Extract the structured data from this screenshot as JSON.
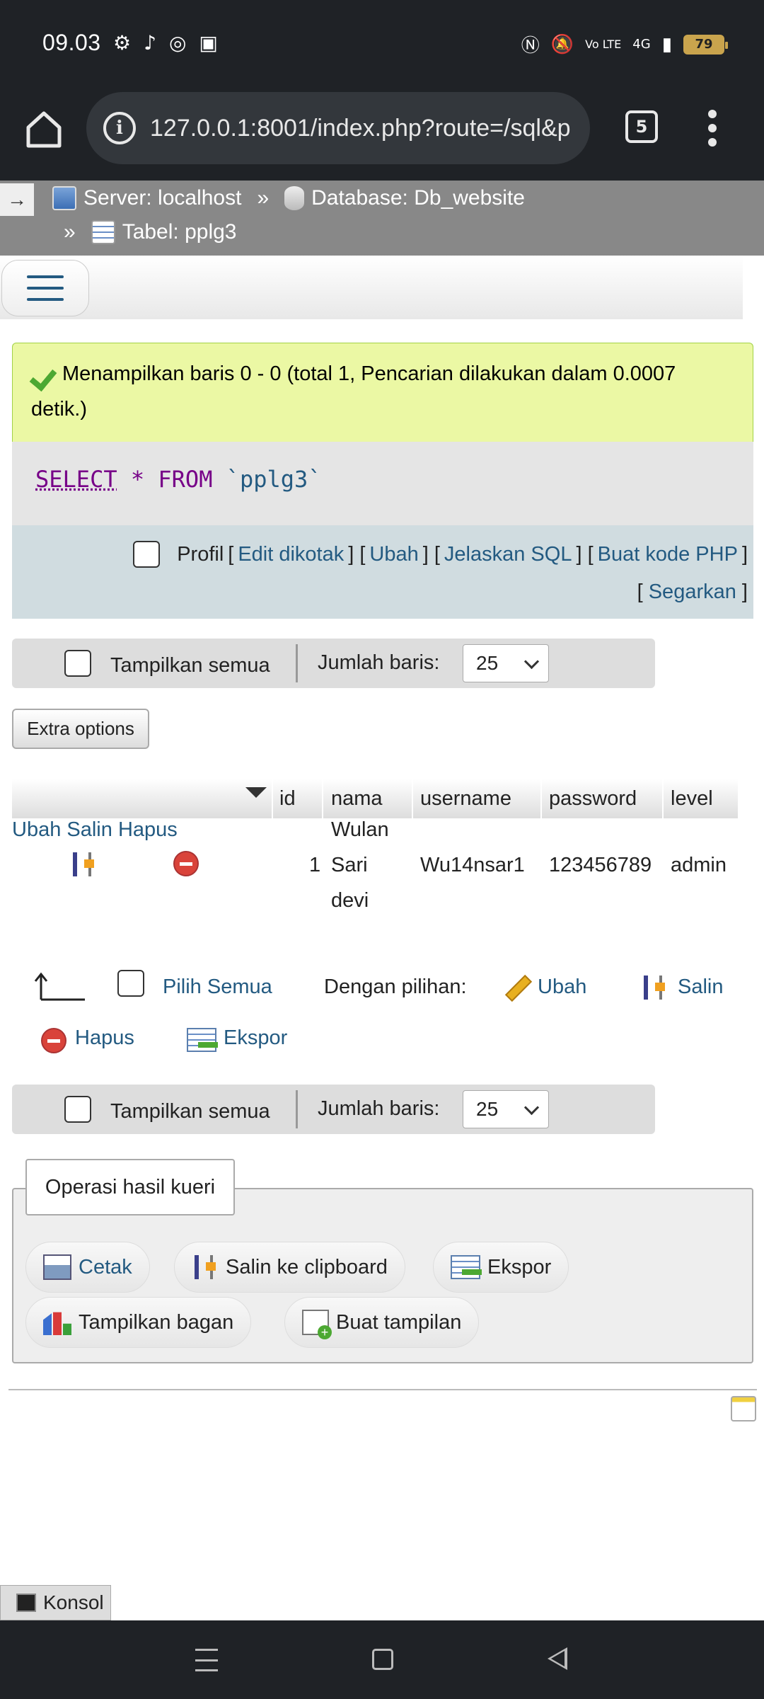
{
  "status_bar": {
    "time": "09.03",
    "battery": "79",
    "network": "4G"
  },
  "browser": {
    "url": "127.0.0.1:8001/index.php?route=/sql&p",
    "tab_count": "5"
  },
  "breadcrumb": {
    "toggle": "→",
    "server": "Server: localhost",
    "database": "Database: Db_website",
    "table": "Tabel: pplg3",
    "sep": "»"
  },
  "success": {
    "message": "Menampilkan baris 0 - 0 (total 1, Pencarian dilakukan dalam 0.0007 detik.)"
  },
  "sql": {
    "select": "SELECT",
    "star": "*",
    "from": "FROM",
    "table": "`pplg3`"
  },
  "profil": {
    "label": "Profil",
    "links": [
      "Edit dikotak",
      "Ubah",
      "Jelaskan SQL",
      "Buat kode PHP",
      "Segarkan"
    ]
  },
  "nav": {
    "show_all": "Tampilkan semua",
    "rows_label": "Jumlah baris:",
    "rows_value": "25"
  },
  "extra_options": "Extra options",
  "table": {
    "columns": [
      "id",
      "nama",
      "username",
      "password",
      "level"
    ],
    "row": {
      "ubah": "Ubah",
      "salin": "Salin",
      "hapus": "Hapus",
      "id": "1",
      "nama_lines": [
        "Wulan",
        "Sari",
        "devi"
      ],
      "username": "Wu14nsar1",
      "password": "123456789",
      "level": "admin"
    }
  },
  "selection": {
    "select_all": "Pilih Semua",
    "with_selected": "Dengan pilihan:",
    "ubah": "Ubah",
    "salin": "Salin",
    "hapus": "Hapus",
    "ekspor": "Ekspor"
  },
  "query_ops": {
    "legend": "Operasi hasil kueri",
    "print": "Cetak",
    "copy_clipboard": "Salin ke clipboard",
    "export": "Ekspor",
    "chart": "Tampilkan bagan",
    "create_view": "Buat tampilan"
  },
  "console": "Konsol",
  "colors": {
    "link": "#235a81",
    "success_bg": "#ebf8a4",
    "chrome_bg": "#1f2226",
    "crumb_bg": "#888888"
  }
}
